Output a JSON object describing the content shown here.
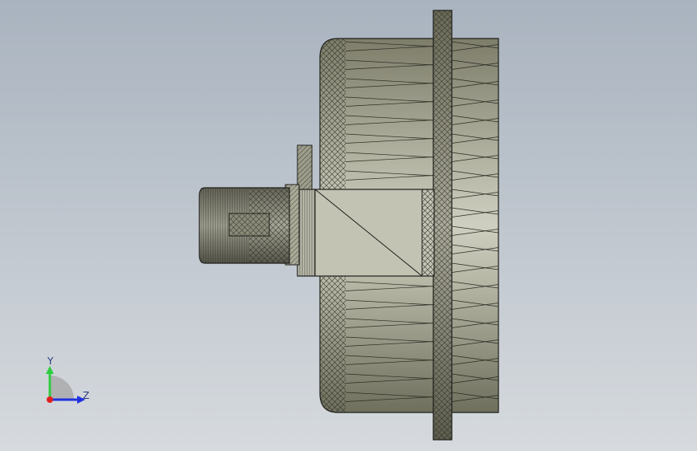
{
  "viewport": {
    "background_top": "#a9b3bf",
    "background_bottom": "#d6dade"
  },
  "model": {
    "shade_color": "#8d8d78",
    "light_color": "#c9c9bb",
    "edge_color": "#222222"
  },
  "triad": {
    "y_label": "Y",
    "z_label": "Z",
    "y_color": "#2ecc40",
    "z_color": "#2030e0",
    "x_color": "#e02020"
  }
}
